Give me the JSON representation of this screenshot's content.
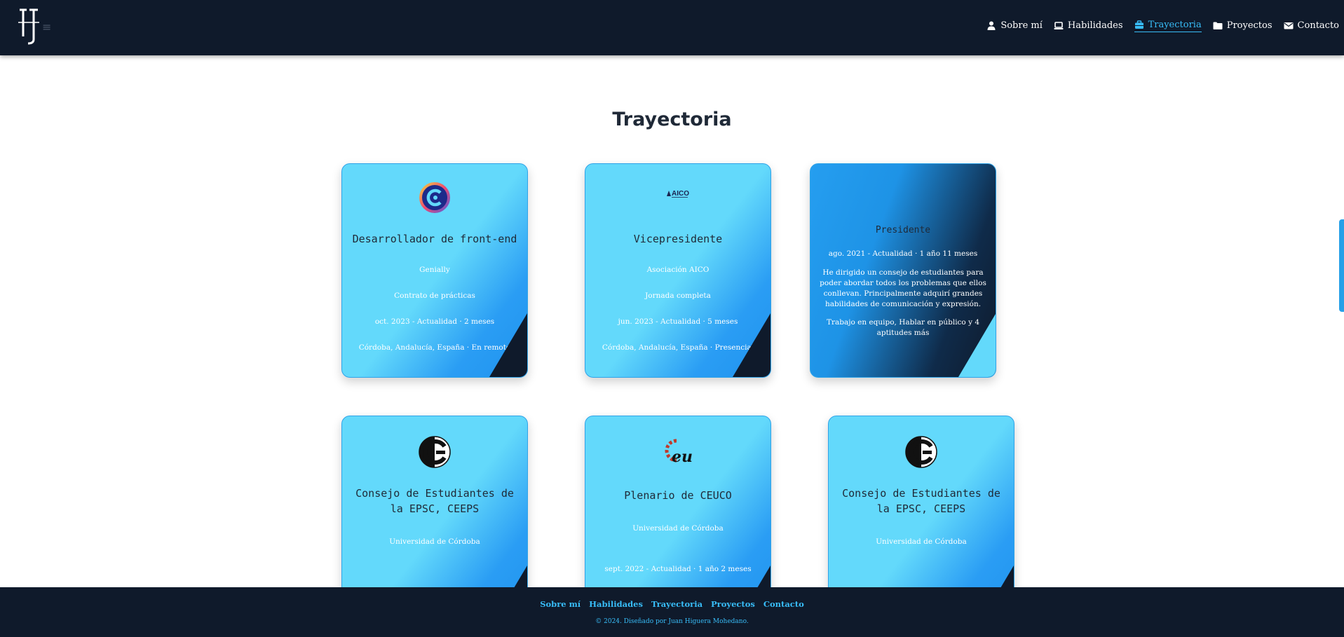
{
  "header": {
    "menu_icon": "hamburger-icon",
    "nav": [
      {
        "label": "Sobre mí",
        "icon": "user-icon"
      },
      {
        "label": "Habilidades",
        "icon": "laptop-icon"
      },
      {
        "label": "Trayectoria",
        "icon": "briefcase-icon",
        "active": true
      },
      {
        "label": "Proyectos",
        "icon": "folder-icon"
      },
      {
        "label": "Contacto",
        "icon": "envelope-icon"
      }
    ]
  },
  "section": {
    "title": "Trayectoria"
  },
  "cards": [
    {
      "logo": "genially-logo",
      "title": "Desarrollador de front-end",
      "company": "Genially",
      "type": "Contrato de prácticas",
      "dates": "oct. 2023 - Actualidad · 2 meses",
      "location": "Córdoba, Andalucía, España · En remoto"
    },
    {
      "logo": "aico-logo",
      "logo_text": "AICO",
      "title": "Vicepresidente",
      "company": "Asociación AICO",
      "type": "Jornada completa",
      "dates": "jun. 2023 - Actualidad · 5 meses",
      "location": "Córdoba, Andalucía, España · Presencial"
    },
    {
      "flipped": true,
      "title": "Presidente",
      "dates": "ago. 2021 - Actualidad · 1 año 11 meses",
      "description": "He dirigido un consejo de estudiantes para poder abordar todos los problemas que ellos conllevan. Principalmente adquirí grandes habilidades de comunicación y expresión.",
      "skills": "Trabajo en equipo, Hablar en público y 4 aptitudes más"
    },
    {
      "logo": "ceeps-logo",
      "title": "Consejo de Estudiantes de la EPSC, CEEPS",
      "company": "Universidad de Córdoba"
    },
    {
      "logo": "ceuco-logo",
      "title": "Plenario de CEUCO",
      "company": "Universidad de Córdoba",
      "dates": "sept. 2022 - Actualidad · 1 año 2 meses"
    },
    {
      "logo": "ceeps-logo",
      "title": "Consejo de Estudiantes de la EPSC, CEEPS",
      "company": "Universidad de Córdoba"
    }
  ],
  "footer": {
    "links": [
      "Sobre mí",
      "Habilidades",
      "Trayectoria",
      "Proyectos",
      "Contacto"
    ],
    "copyright": "© 2024. Diseñado por Juan Higuera Mohedano."
  },
  "colors": {
    "header_bg": "#0f1a2b",
    "accent": "#38bdf8",
    "card_light": "#63d9fb",
    "card_blue": "#1f93ee"
  }
}
